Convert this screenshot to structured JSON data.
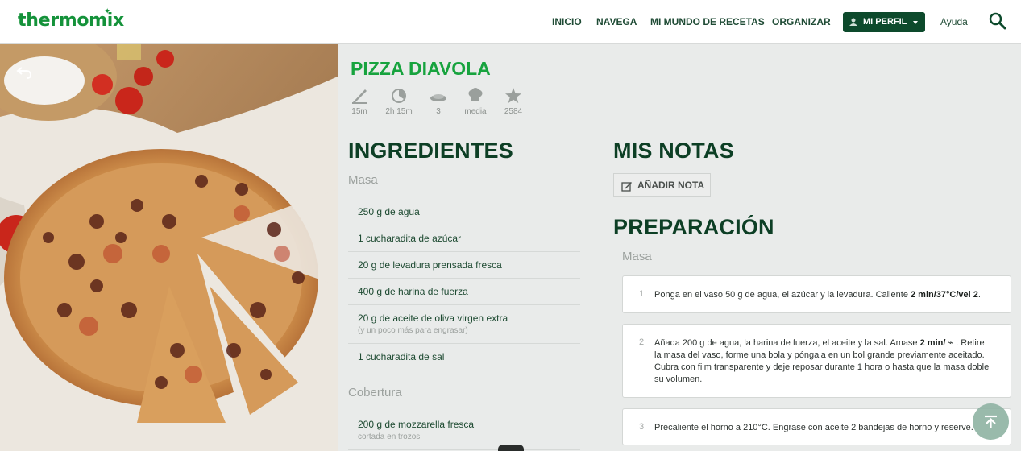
{
  "header": {
    "logo": "thermomix",
    "nav": [
      "INICIO",
      "NAVEGA",
      "MI MUNDO DE RECETAS",
      "ORGANIZAR"
    ],
    "profile": "MI PERFIL",
    "help": "Ayuda"
  },
  "recipe": {
    "title": "PIZZA DIAVOLA",
    "stats": [
      {
        "icon": "knife-icon",
        "label": "15m"
      },
      {
        "icon": "timer-icon",
        "label": "2h 15m"
      },
      {
        "icon": "servings-icon",
        "label": "3"
      },
      {
        "icon": "chef-hat-icon",
        "label": "media"
      },
      {
        "icon": "star-icon",
        "label": "2584"
      }
    ]
  },
  "ingredients": {
    "heading": "INGREDIENTES",
    "groups": [
      {
        "name": "Masa",
        "items": [
          {
            "text": "250 g de agua",
            "note": ""
          },
          {
            "text": "1 cucharadita de azúcar",
            "note": ""
          },
          {
            "text": "20 g de levadura prensada fresca",
            "note": ""
          },
          {
            "text": "400 g de harina de fuerza",
            "note": ""
          },
          {
            "text": "20 g de aceite de oliva virgen extra",
            "note": "(y un poco más para engrasar)"
          },
          {
            "text": "1 cucharadita de sal",
            "note": ""
          }
        ]
      },
      {
        "name": "Cobertura",
        "items": [
          {
            "text": "200 g de mozzarella fresca",
            "note": "cortada en trozos"
          }
        ]
      }
    ]
  },
  "notes": {
    "heading": "MIS NOTAS",
    "add_label": "AÑADIR NOTA"
  },
  "preparation": {
    "heading": "PREPARACIÓN",
    "group": "Masa",
    "steps": [
      {
        "num": "1",
        "pre": "Ponga en el vaso 50 g de agua, el azúcar y la levadura. Caliente ",
        "bold": "2 min/37°C/vel 2",
        "post": "."
      },
      {
        "num": "2",
        "pre": "Añada 200 g de agua, la harina de fuerza, el aceite y la sal. Amase ",
        "bold": "2 min/",
        "post": " ⌁ . Retire la masa del vaso, forme una bola y póngala en un bol grande previamente aceitado. Cubra con film transparente y deje reposar durante 1 hora o hasta que la masa doble su volumen."
      },
      {
        "num": "3",
        "pre": "Precaliente el horno a 210°C. Engrase con aceite 2 bandejas de horno y reserve.",
        "bold": "",
        "post": ""
      }
    ]
  },
  "colors": {
    "brand": "#14923a",
    "title": "#17a33e",
    "dark_green": "#0d4a2c"
  }
}
